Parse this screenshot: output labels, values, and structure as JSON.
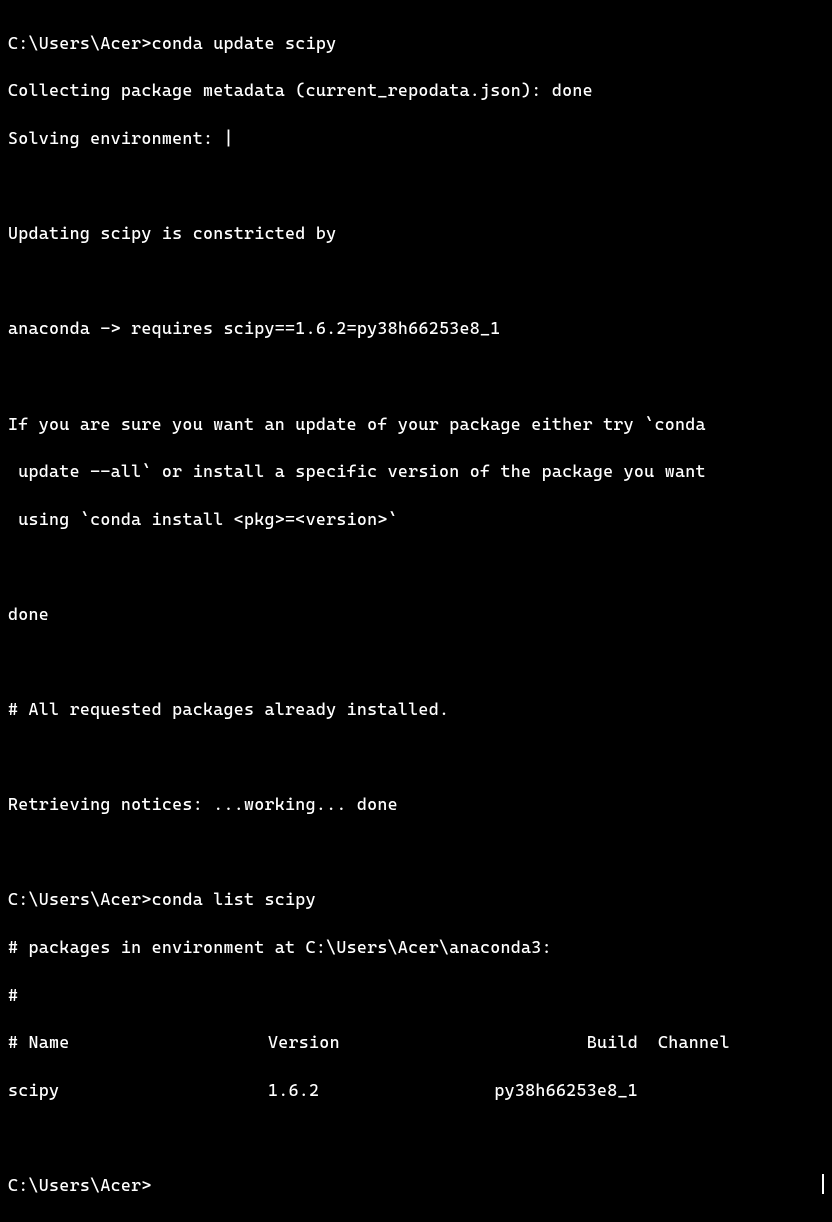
{
  "terminal": {
    "prompt": "C:\\Users\\Acer>",
    "commands": {
      "update": "conda update scipy",
      "list": "conda list scipy"
    },
    "output": {
      "collecting": "Collecting package metadata (current_repodata.json): done",
      "solving": "Solving environment: |",
      "constricted": "Updating scipy is constricted by",
      "requires": "anaconda -> requires scipy==1.6.2=py38h66253e8_1",
      "advice1": "If you are sure you want an update of your package either try `conda",
      "advice2": " update --all` or install a specific version of the package you want",
      "advice3": " using `conda install <pkg>=<version>`",
      "done": "done",
      "installed": "# All requested packages already installed.",
      "retrieving": "Retrieving notices: ...working... done",
      "env_path": "# packages in environment at C:\\Users\\Acer\\anaconda3:",
      "hash": "#"
    },
    "table": {
      "header": {
        "name": "# Name",
        "version": "Version",
        "build": "Build",
        "channel": "Channel"
      },
      "row": {
        "name": "scipy",
        "version": "1.6.2",
        "build": "py38h66253e8_1",
        "channel": ""
      }
    }
  }
}
